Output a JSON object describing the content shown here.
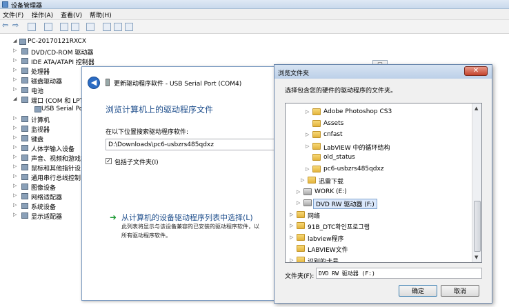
{
  "device_manager": {
    "title": "设备管理器",
    "menu": [
      "文件(F)",
      "操作(A)",
      "查看(V)",
      "帮助(H)"
    ],
    "tree": [
      {
        "label": "PC-20170121RXCX",
        "indent": 0,
        "expander": "◢"
      },
      {
        "label": "DVD/CD-ROM 驱动器",
        "indent": 1,
        "expander": "▷"
      },
      {
        "label": "IDE ATA/ATAPI 控制器",
        "indent": 1,
        "expander": "▷"
      },
      {
        "label": "处理器",
        "indent": 1,
        "expander": "▷"
      },
      {
        "label": "磁盘驱动器",
        "indent": 1,
        "expander": "▷"
      },
      {
        "label": "电池",
        "indent": 1,
        "expander": "▷"
      },
      {
        "label": "端口 (COM 和 LPT",
        "indent": 1,
        "expander": "◢"
      },
      {
        "label": "USB Serial Por",
        "indent": 2,
        "expander": ""
      },
      {
        "label": "计算机",
        "indent": 1,
        "expander": "▷"
      },
      {
        "label": "监视器",
        "indent": 1,
        "expander": "▷"
      },
      {
        "label": "键盘",
        "indent": 1,
        "expander": "▷"
      },
      {
        "label": "人体学输入设备",
        "indent": 1,
        "expander": "▷"
      },
      {
        "label": "声音、视频和游戏控",
        "indent": 1,
        "expander": "▷"
      },
      {
        "label": "鼠标和其他指针设",
        "indent": 1,
        "expander": "▷"
      },
      {
        "label": "通用串行总线控制",
        "indent": 1,
        "expander": "▷"
      },
      {
        "label": "图像设备",
        "indent": 1,
        "expander": "▷"
      },
      {
        "label": "网络适配器",
        "indent": 1,
        "expander": "▷"
      },
      {
        "label": "系统设备",
        "indent": 1,
        "expander": "▷"
      },
      {
        "label": "显示适配器",
        "indent": 1,
        "expander": "▷"
      }
    ]
  },
  "wizard": {
    "title": "更新驱动程序软件 - USB Serial Port (COM4)",
    "heading": "浏览计算机上的驱动程序文件",
    "location_label": "在以下位置搜索驱动程序软件:",
    "path_value": "D:\\Downloads\\pc6-usbzrs485qdxz",
    "include_subfolders_label": "包括子文件夹(I)",
    "include_subfolders_checked": true,
    "check_glyph": "✓",
    "back_glyph": "◀",
    "pick_arrow_glyph": "➜",
    "pick_label": "从计算机的设备驱动程序列表中选择(L)",
    "pick_desc_line1": "此列表将显示与该设备兼容的已安装的驱动程序软件，以",
    "pick_desc_line2": "所有驱动程序软件。"
  },
  "browse_dialog": {
    "title": "浏览文件夹",
    "close_glyph": "✕",
    "prompt": "选择包含您的硬件的驱动程序的文件夹。",
    "items": [
      {
        "label": "Adobe Photoshop CS3",
        "indent": 2,
        "expander": "▷",
        "kind": "folder"
      },
      {
        "label": "Assets",
        "indent": 2,
        "expander": "",
        "kind": "folder"
      },
      {
        "label": "cnfast",
        "indent": 2,
        "expander": "▷",
        "kind": "folder"
      },
      {
        "label": "LabVIEW 中的循环结构",
        "indent": 2,
        "expander": "▷",
        "kind": "folder"
      },
      {
        "label": "old_status",
        "indent": 2,
        "expander": "",
        "kind": "folder"
      },
      {
        "label": "pc6-usbzrs485qdxz",
        "indent": 2,
        "expander": "▷",
        "kind": "folder"
      },
      {
        "label": "迅雷下载",
        "indent": 1,
        "expander": "▷",
        "kind": "folder"
      },
      {
        "label": "WORK (E:)",
        "indent": 0,
        "expander": "▷",
        "kind": "drive"
      },
      {
        "label": "DVD RW 驱动器 (F:)",
        "indent": 0,
        "expander": "▷",
        "kind": "drive",
        "selected": true
      },
      {
        "label": "网络",
        "indent": -1,
        "expander": "▷",
        "kind": "folder"
      },
      {
        "label": "91B_DTC확인프로그램",
        "indent": -1,
        "expander": "▷",
        "kind": "folder"
      },
      {
        "label": "labview程序",
        "indent": -1,
        "expander": "▷",
        "kind": "folder"
      },
      {
        "label": "LABVIEW文件",
        "indent": -1,
        "expander": "",
        "kind": "folder"
      },
      {
        "label": "识别的卡号",
        "indent": -1,
        "expander": "▷",
        "kind": "folder"
      }
    ],
    "folder_label": "文件夹(F):",
    "folder_value": "DVD RW 驱动器 (F:)",
    "ok_label": "确定",
    "cancel_label": "取消",
    "scroll_up_glyph": "▲",
    "scroll_down_glyph": "▼"
  },
  "colors": {
    "accent_link": "#1e4e8c",
    "green_arrow": "#1d9a34",
    "close_red": "#c3432c"
  }
}
